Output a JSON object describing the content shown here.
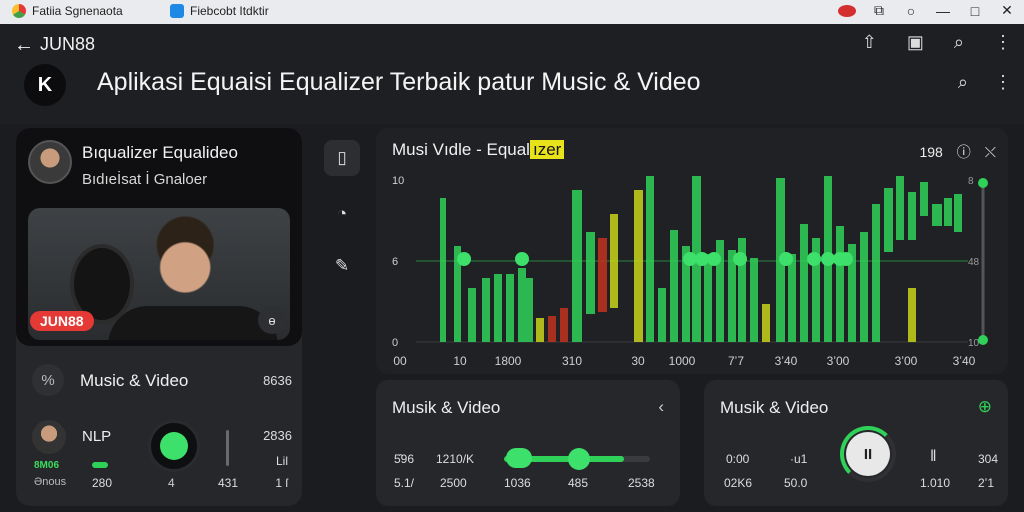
{
  "titlebar": {
    "tab1": "Fatiia Sgnenaota",
    "tab2": "Fiebcobt Itdktir",
    "controls": [
      "⧉",
      "○",
      "—",
      "□",
      "✕"
    ]
  },
  "appbar": {
    "back_icon": "arrow-left-icon",
    "brand": "JUN88",
    "icons": [
      "share-icon",
      "bookmark-icon",
      "search-icon",
      "more-icon"
    ],
    "logo_letter": "K",
    "headline": "Aplikasi Equaisi Equalizer Terbaik patur Music & Video"
  },
  "left_card": {
    "title": "Bıqualizer Equalideo",
    "subtitle": "Bıdıeİsat İ Gnaloer",
    "badge": "JUN88",
    "photo_button": "ɵ",
    "row_label": "Music & Video",
    "row_value": "8636",
    "nlp": "NLP",
    "green_tag": "8M06",
    "small_a": "Ənous",
    "small_b": "280",
    "small_c": "4",
    "small_d": "431",
    "small_e": "2836",
    "small_f": "Lil",
    "small_g": "1 ſ"
  },
  "tools": [
    "phone-icon",
    "gauge-icon",
    "eyedropper-icon"
  ],
  "equalizer": {
    "title_prefix": "Musi Vıdle -",
    "title_eq": "Equal",
    "title_hl": "ızer",
    "value": "198",
    "y_labels": [
      "10",
      "6",
      "0"
    ],
    "y_labels_right": [
      "8",
      "48",
      "10"
    ],
    "x_labels": [
      "00",
      "10",
      "1800",
      "310",
      "30",
      "1000",
      "7ʼ7",
      "3ʼ40",
      "3ʼ00",
      "3ʼ00",
      "3ʼ40"
    ],
    "green": "#30d158",
    "yellow": "#c9d41a",
    "red": "#b8321e"
  },
  "card_mid": {
    "title": "Musik & Video",
    "t1": "5̂96",
    "t2": "1210/K",
    "t3": "5.1/",
    "t4": "2500",
    "t5": "1036",
    "t6": "485",
    "t7": "2538",
    "slider_level": 0.82
  },
  "card_right": {
    "title": "Musik & Video",
    "t1": "0:00",
    "t2": "·u1",
    "t3": "02K6",
    "t4": "50.0",
    "t5": "1.010",
    "t6": "304",
    "t7": "2ʼ1",
    "pause": "II"
  }
}
